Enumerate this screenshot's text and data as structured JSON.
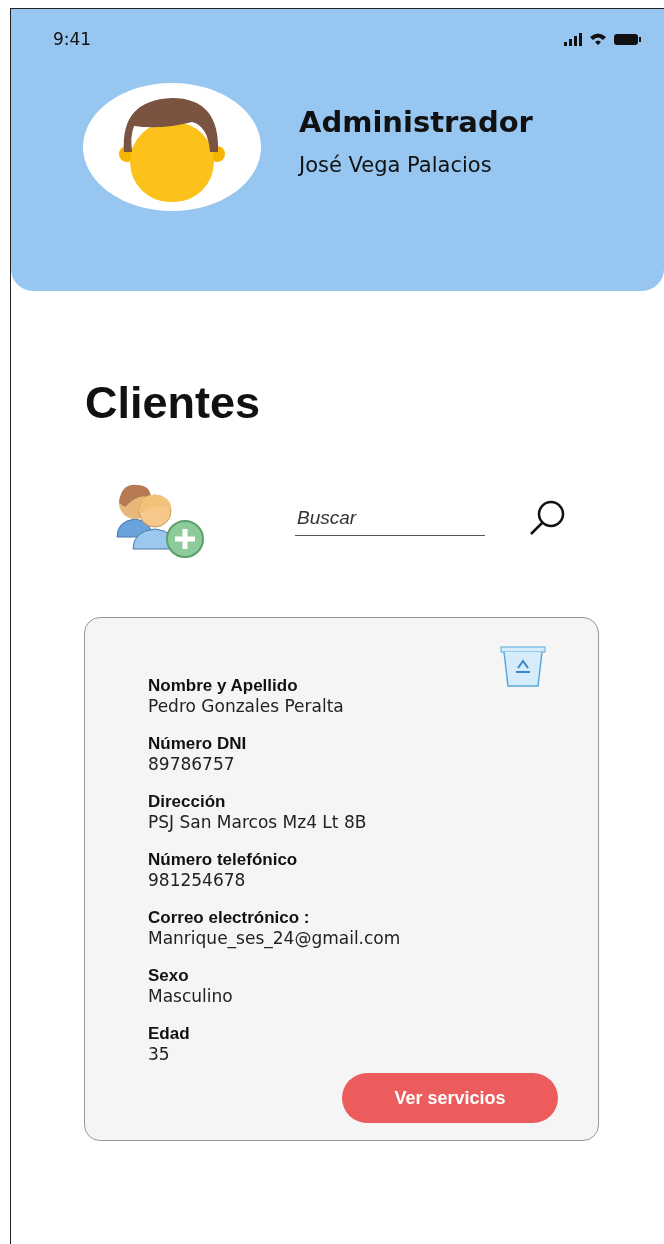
{
  "status_bar": {
    "time": "9:41"
  },
  "profile": {
    "role": "Administrador",
    "name": "José Vega Palacios"
  },
  "page_title": "Clientes",
  "search": {
    "placeholder": "Buscar"
  },
  "client": {
    "fields": [
      {
        "label": "Nombre y Apellido",
        "value": "Pedro Gonzales Peralta"
      },
      {
        "label": "Número DNI",
        "value": "89786757"
      },
      {
        "label": "Dirección",
        "value": "PSJ San Marcos Mz4 Lt 8B"
      },
      {
        "label": "Número telefónico",
        "value": "981254678"
      },
      {
        "label": "Correo electrónico :",
        "value": "Manrique_ses_24@gmail.com"
      },
      {
        "label": "Sexo",
        "value": "Masculino"
      },
      {
        "label": "Edad",
        "value": "35"
      }
    ],
    "button": "Ver servicios"
  }
}
